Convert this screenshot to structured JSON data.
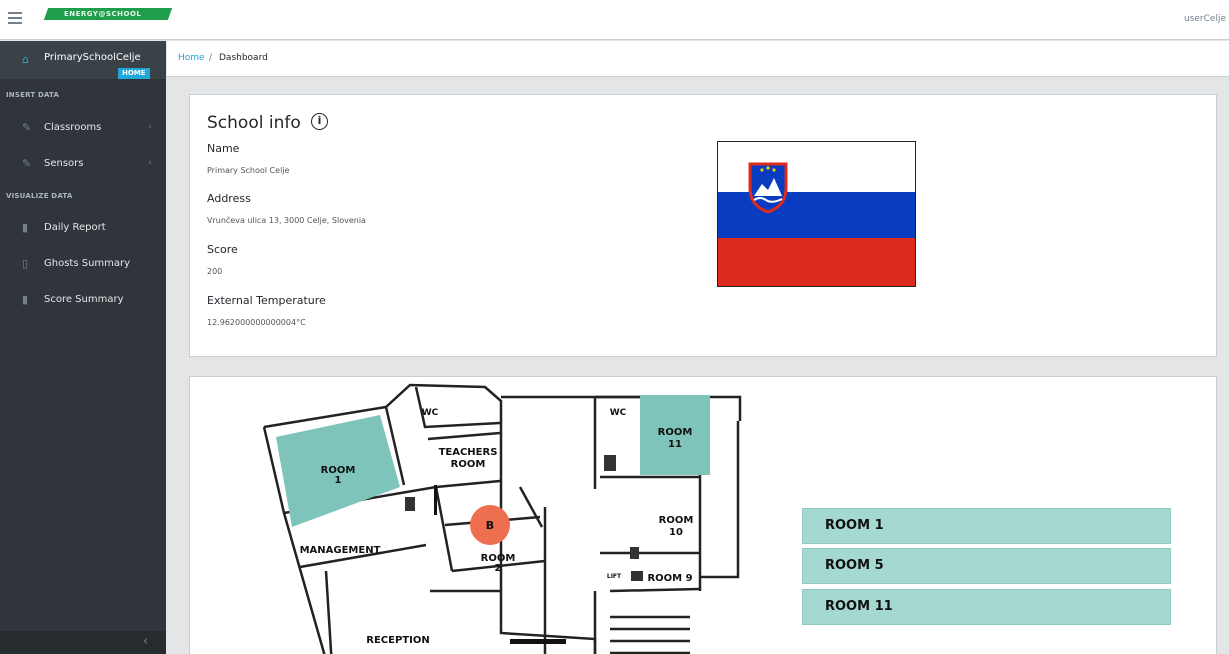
{
  "header": {
    "brand": "ENERGY@SCHOOL",
    "user": "userCelje"
  },
  "sidebar": {
    "school": "PrimarySchoolCelje",
    "badge": "HOME",
    "section_insert": "INSERT DATA",
    "section_visualize": "VISUALIZE DATA",
    "items": [
      {
        "label": "Classrooms",
        "icon": "pencil-icon"
      },
      {
        "label": "Sensors",
        "icon": "pencil-icon"
      },
      {
        "label": "Daily Report",
        "icon": "bar-chart-icon"
      },
      {
        "label": "Ghosts Summary",
        "icon": "document-icon"
      },
      {
        "label": "Score Summary",
        "icon": "bar-chart-icon"
      }
    ]
  },
  "breadcrumb": {
    "home": "Home",
    "separator": "/",
    "current": "Dashboard"
  },
  "school_info": {
    "title": "School info",
    "info_icon": "i",
    "name_label": "Name",
    "name_value": "Primary School Celje",
    "address_label": "Address",
    "address_value": "Vrunčeva ulica 13, 3000 Celje, Slovenia",
    "score_label": "Score",
    "score_value": "200",
    "temp_label": "External Temperature",
    "temp_value": "12.962000000000004°C"
  },
  "floorplan": {
    "rooms": [
      "ROOM 1",
      "ROOM 5",
      "ROOM 11"
    ],
    "labels": {
      "wc1": "WC",
      "wc2": "WC",
      "teachers": "TEACHERS",
      "teachers2": "ROOM",
      "room1a": "ROOM",
      "room1b": "1",
      "room11a": "ROOM",
      "room11b": "11",
      "room10a": "ROOM",
      "room10b": "10",
      "room2a": "ROOM",
      "room2b": "2",
      "room9": "ROOM 9",
      "management": "MANAGEMENT",
      "reception": "RECEPTION",
      "lift": "LIFT",
      "marker": "B"
    },
    "colors": {
      "highlight": "#7fc4ba",
      "marker": "#ee6f4f"
    }
  }
}
